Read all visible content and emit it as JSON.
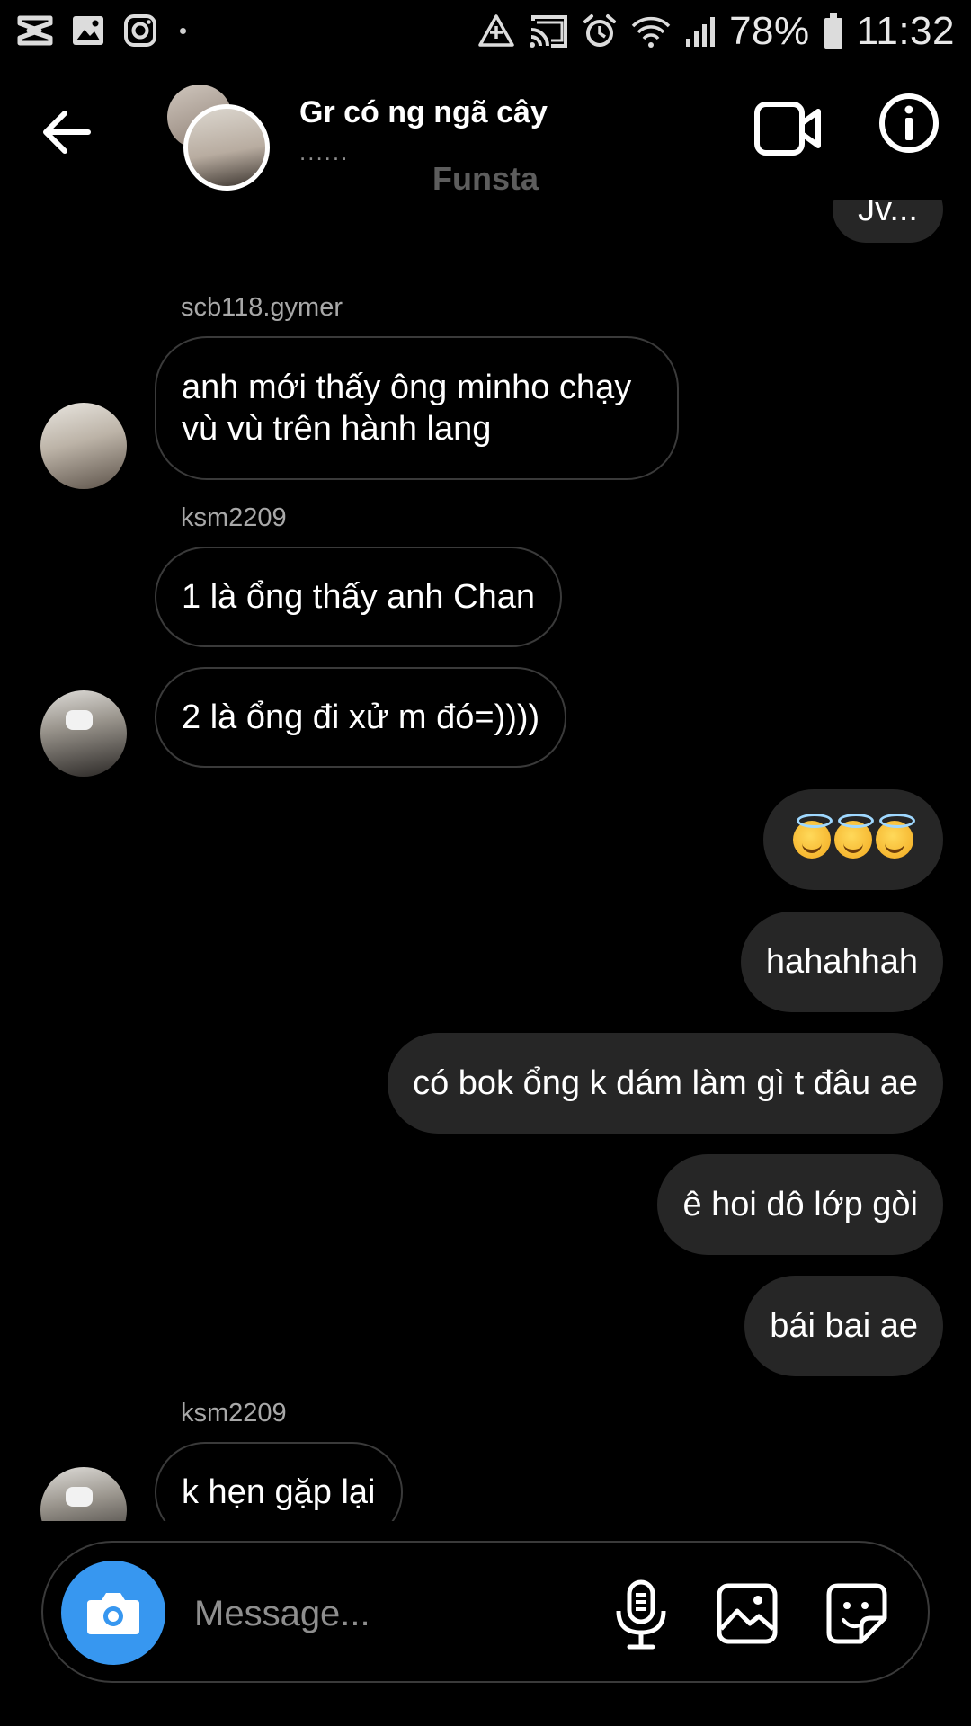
{
  "status_bar": {
    "left_icons": [
      "capcut-icon",
      "gallery-notification-icon",
      "instagram-icon",
      "dot-icon"
    ],
    "right_icons": [
      "data-saver-icon",
      "cast-icon",
      "alarm-icon",
      "wifi-icon",
      "signal-icon",
      "battery-icon"
    ],
    "battery": "78%",
    "time": "11:32"
  },
  "header": {
    "title": "Gr có ng ngã cây",
    "subtitle": "......",
    "banner": "Funsta"
  },
  "messages": [
    {
      "type": "out",
      "text": "Jv..."
    },
    {
      "type": "in",
      "sender": "scb118.gymer",
      "lines": [
        "anh mới thấy ông minho chạy",
        "vù vù trên hành lang"
      ]
    },
    {
      "type": "in",
      "sender": "ksm2209",
      "text": "1 là ổng thấy anh Chan"
    },
    {
      "type": "in",
      "text": "2 là ổng đi xử m đó=))))"
    },
    {
      "type": "out",
      "emoji": "smiling-face-with-halo x3"
    },
    {
      "type": "out",
      "text": "hahahhah"
    },
    {
      "type": "out",
      "text": "có bok ổng k dám làm gì t đâu ae"
    },
    {
      "type": "out",
      "text": "ê hoi dô lớp gòi"
    },
    {
      "type": "out",
      "text": "bái bai ae"
    },
    {
      "type": "in",
      "sender": "ksm2209",
      "text": "k hẹn gặp lại"
    }
  ],
  "composer": {
    "placeholder": "Message..."
  },
  "colors": {
    "background": "#000000",
    "outgoing_bubble": "#262626",
    "incoming_border": "#3a3a3a",
    "camera_button": "#3797f0",
    "secondary_text": "#a8a8a8"
  }
}
